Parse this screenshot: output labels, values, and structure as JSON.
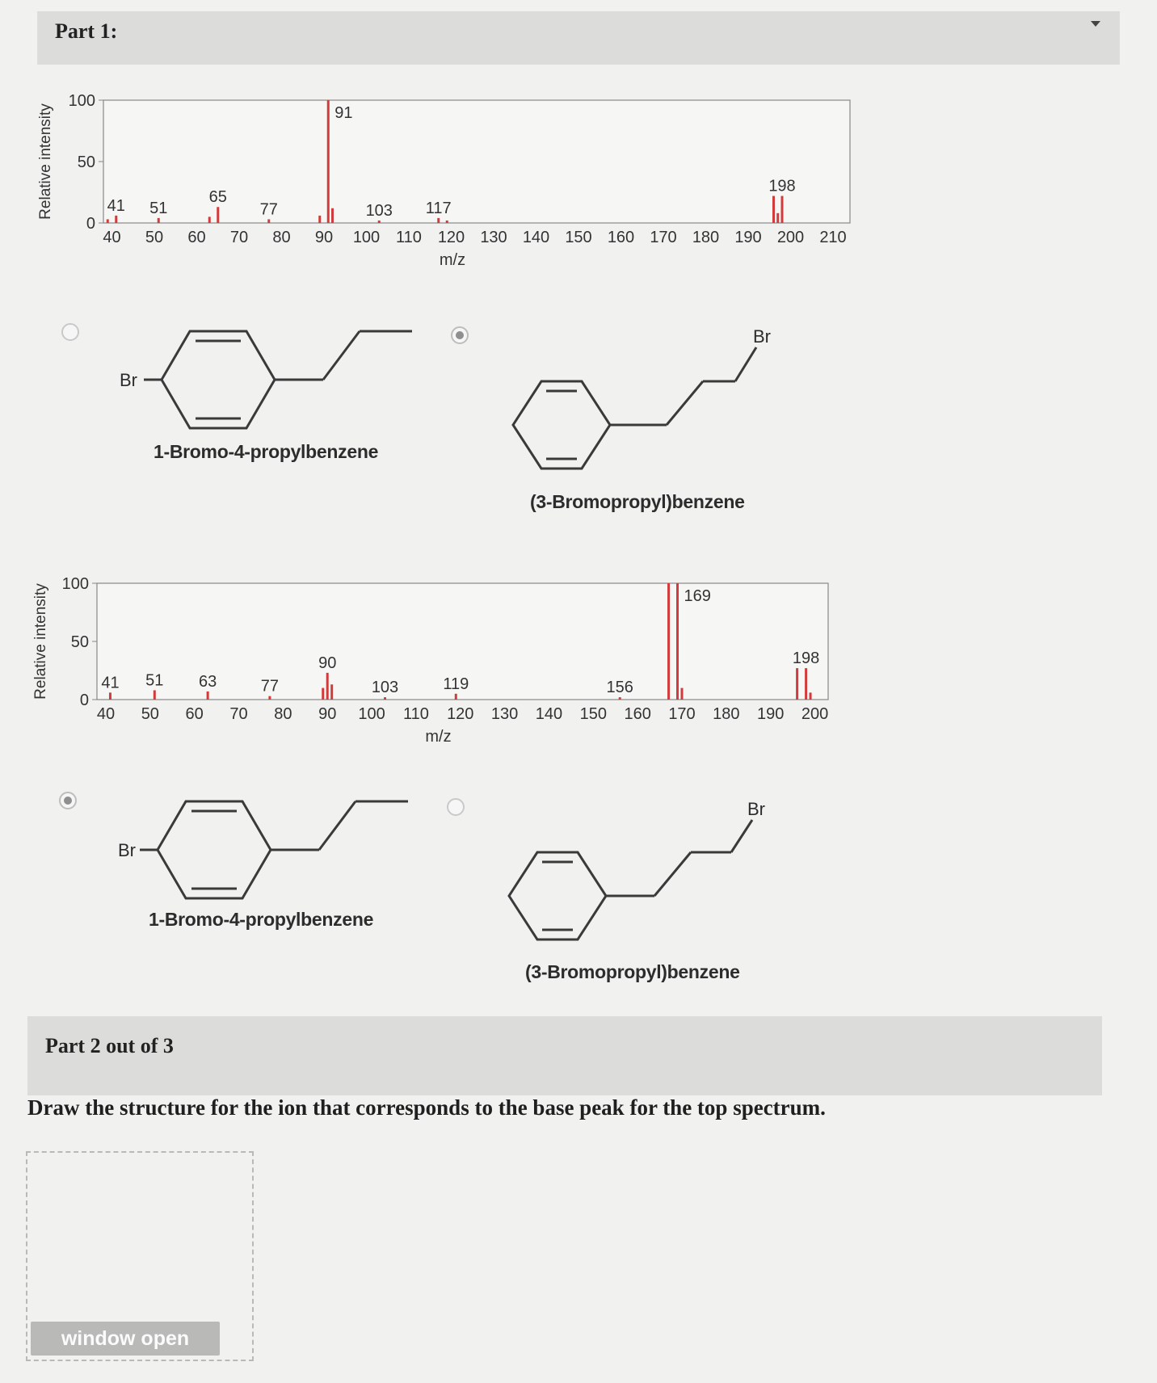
{
  "part1": {
    "title": "Part 1:"
  },
  "part2": {
    "title": "Part 2 out of 3",
    "question": "Draw the structure for the ion that corresponds to the base peak for the top spectrum.",
    "window_button": "window open"
  },
  "spectrum_top": {
    "ylabel": "Relative intensity",
    "xlabel": "m/z",
    "y_ticks": [
      "0",
      "50",
      "100"
    ],
    "x_ticks": [
      "40",
      "50",
      "60",
      "70",
      "80",
      "90",
      "100",
      "110",
      "120",
      "130",
      "140",
      "150",
      "160",
      "170",
      "180",
      "190",
      "200",
      "210"
    ],
    "peak_labels": [
      "41",
      "51",
      "65",
      "77",
      "91",
      "103",
      "117",
      "198"
    ]
  },
  "spectrum_bottom": {
    "ylabel": "Relative intensity",
    "xlabel": "m/z",
    "y_ticks": [
      "0",
      "50",
      "100"
    ],
    "x_ticks": [
      "40",
      "50",
      "60",
      "70",
      "80",
      "90",
      "100",
      "110",
      "120",
      "130",
      "140",
      "150",
      "160",
      "170",
      "180",
      "190",
      "200"
    ],
    "peak_labels": [
      "41",
      "51",
      "63",
      "77",
      "90",
      "103",
      "119",
      "156",
      "169",
      "198"
    ]
  },
  "options_top": [
    {
      "name": "1-Bromo-4-propylbenzene",
      "br": "Br",
      "selected": false
    },
    {
      "name": "(3-Bromopropyl)benzene",
      "br": "Br",
      "selected": true
    }
  ],
  "options_bottom": [
    {
      "name": "1-Bromo-4-propylbenzene",
      "br": "Br",
      "selected": true
    },
    {
      "name": "(3-Bromopropyl)benzene",
      "br": "Br",
      "selected": false
    }
  ],
  "chart_data": [
    {
      "type": "bar",
      "title": "",
      "xlabel": "m/z",
      "ylabel": "Relative intensity",
      "xlim": [
        38,
        214
      ],
      "ylim": [
        0,
        100
      ],
      "grid": false,
      "peaks": [
        {
          "x": 39,
          "y": 3
        },
        {
          "x": 41,
          "y": 6
        },
        {
          "x": 51,
          "y": 4
        },
        {
          "x": 63,
          "y": 5
        },
        {
          "x": 65,
          "y": 13
        },
        {
          "x": 77,
          "y": 3
        },
        {
          "x": 89,
          "y": 6
        },
        {
          "x": 91,
          "y": 100
        },
        {
          "x": 92,
          "y": 12
        },
        {
          "x": 103,
          "y": 2
        },
        {
          "x": 117,
          "y": 4
        },
        {
          "x": 119,
          "y": 2
        },
        {
          "x": 196,
          "y": 22
        },
        {
          "x": 198,
          "y": 22
        },
        {
          "x": 197,
          "y": 8
        }
      ],
      "labeled_peaks": [
        41,
        51,
        65,
        77,
        91,
        103,
        117,
        198
      ]
    },
    {
      "type": "bar",
      "title": "",
      "xlabel": "m/z",
      "ylabel": "Relative intensity",
      "xlim": [
        38,
        203
      ],
      "ylim": [
        0,
        100
      ],
      "grid": false,
      "peaks": [
        {
          "x": 41,
          "y": 6
        },
        {
          "x": 51,
          "y": 8
        },
        {
          "x": 63,
          "y": 7
        },
        {
          "x": 77,
          "y": 3
        },
        {
          "x": 89,
          "y": 10
        },
        {
          "x": 90,
          "y": 23
        },
        {
          "x": 91,
          "y": 13
        },
        {
          "x": 103,
          "y": 2
        },
        {
          "x": 119,
          "y": 5
        },
        {
          "x": 156,
          "y": 2
        },
        {
          "x": 167,
          "y": 100
        },
        {
          "x": 169,
          "y": 100
        },
        {
          "x": 170,
          "y": 10
        },
        {
          "x": 196,
          "y": 27
        },
        {
          "x": 198,
          "y": 27
        },
        {
          "x": 199,
          "y": 6
        }
      ],
      "labeled_peaks": [
        41,
        51,
        63,
        77,
        90,
        103,
        119,
        156,
        169,
        198
      ]
    }
  ]
}
